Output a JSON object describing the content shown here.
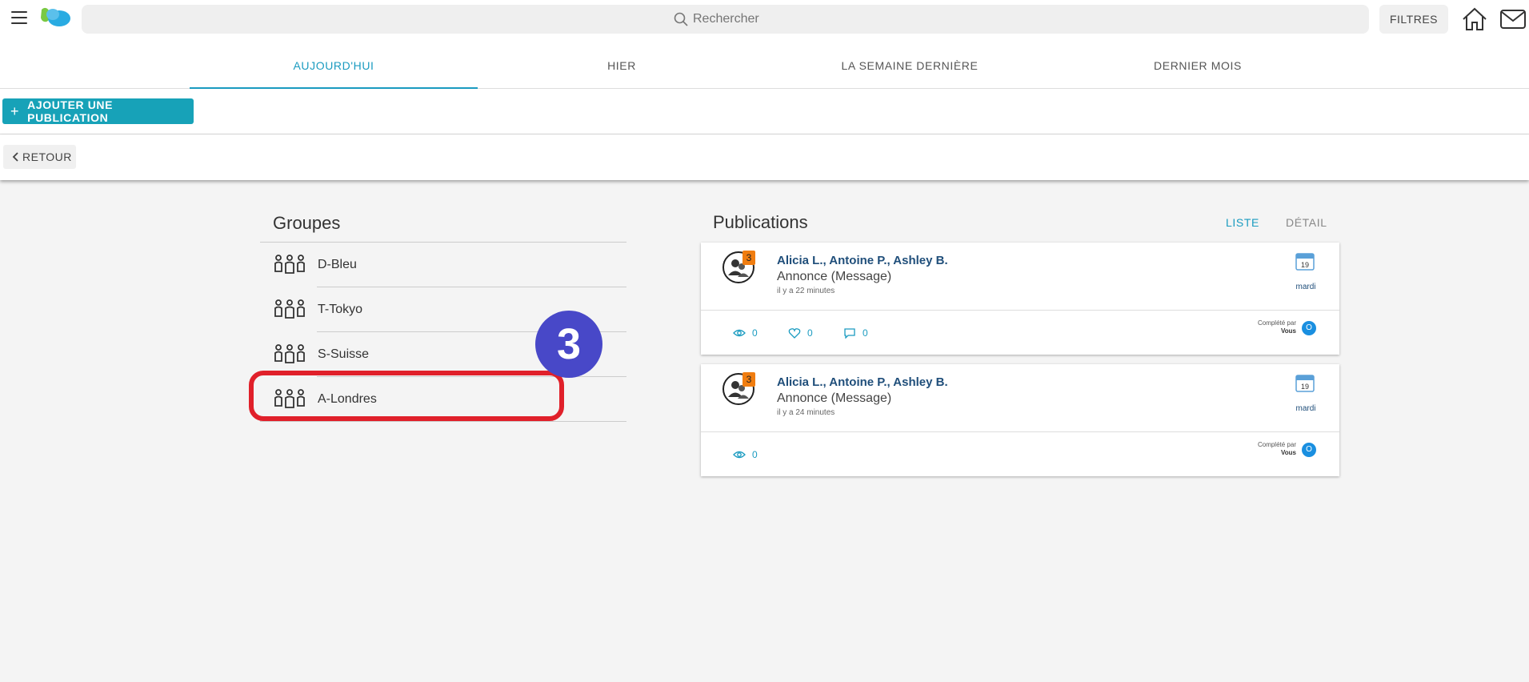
{
  "header": {
    "search_placeholder": "Rechercher",
    "filters_label": "FILTRES"
  },
  "tabs": [
    {
      "label": "AUJOURD'HUI",
      "active": true
    },
    {
      "label": "HIER"
    },
    {
      "label": "LA SEMAINE DERNIÈRE"
    },
    {
      "label": "DERNIER MOIS"
    }
  ],
  "toolbar": {
    "add_label": "AJOUTER UNE PUBLICATION",
    "back_label": "RETOUR"
  },
  "groups": {
    "title": "Groupes",
    "items": [
      {
        "name": "D-Bleu"
      },
      {
        "name": "T-Tokyo"
      },
      {
        "name": "S-Suisse"
      },
      {
        "name": "A-Londres"
      }
    ]
  },
  "annotation": {
    "step": "3"
  },
  "publications": {
    "title": "Publications",
    "view_list": "LISTE",
    "view_detail": "DÉTAIL",
    "items": [
      {
        "participants_count": "3",
        "names": "Alicia L., Antoine P., Ashley B.",
        "type": "Annonce (Message)",
        "time": "il y a 22 minutes",
        "calendar_day": "19",
        "weekday": "mardi",
        "views": "0",
        "likes": "0",
        "comments": "0",
        "completed_label": "Complété par",
        "completed_by": "Vous",
        "completed_initial": "O"
      },
      {
        "participants_count": "3",
        "names": "Alicia L., Antoine P., Ashley B.",
        "type": "Annonce (Message)",
        "time": "il y a 24 minutes",
        "calendar_day": "19",
        "weekday": "mardi",
        "views": "0",
        "completed_label": "Complété par",
        "completed_by": "Vous",
        "completed_initial": "O"
      }
    ]
  },
  "colors": {
    "accent": "#1a9bc0",
    "button": "#17a2b8",
    "highlight": "#e0202a",
    "step_badge": "#4848c8",
    "participant_badge": "#f07d10"
  }
}
